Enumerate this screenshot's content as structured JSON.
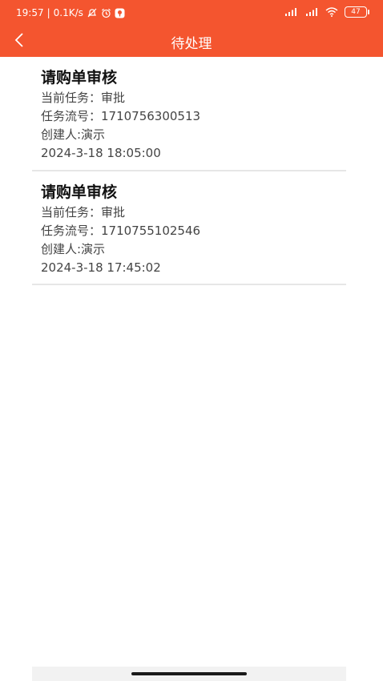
{
  "status_bar": {
    "time": "19:57",
    "speed": "0.1K/s",
    "battery": "47"
  },
  "nav": {
    "title": "待处理"
  },
  "tasks": [
    {
      "title": "请购单审核",
      "current_task": "当前任务：审批",
      "serial": "任务流号：1710756300513",
      "creator": "创建人:演示",
      "datetime": "2024-3-18 18:05:00"
    },
    {
      "title": "请购单审核",
      "current_task": "当前任务：审批",
      "serial": "任务流号：1710755102546",
      "creator": "创建人:演示",
      "datetime": "2024-3-18 17:45:02"
    }
  ],
  "colors": {
    "header": "#f4552f"
  }
}
